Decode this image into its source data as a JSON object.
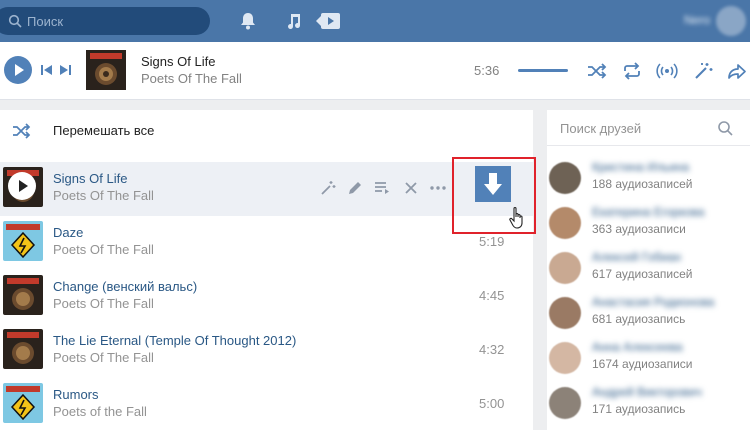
{
  "header": {
    "search_placeholder": "Поиск",
    "user_name": "Nero"
  },
  "player": {
    "title": "Signs Of Life",
    "artist": "Poets Of The Fall",
    "time": "5:36",
    "progress": 0.0
  },
  "list": {
    "shuffle_label": "Перемешать все",
    "tracks": [
      {
        "title": "Signs Of Life",
        "artist": "Poets Of The Fall",
        "time": ""
      },
      {
        "title": "Daze",
        "artist": "Poets Of The Fall",
        "time": "5:19"
      },
      {
        "title": "Change (венский вальс)",
        "artist": "Poets Of The Fall",
        "time": "4:45"
      },
      {
        "title": "The Lie Eternal (Temple Of Thought 2012)",
        "artist": "Poets Of The Fall",
        "time": "4:32"
      },
      {
        "title": "Rumors",
        "artist": "Poets of the Fall",
        "time": "5:00"
      }
    ]
  },
  "friends": {
    "search_placeholder": "Поиск друзей",
    "items": [
      {
        "name": "Кристина Ильина",
        "count": "188 аудиозаписей"
      },
      {
        "name": "Екатерина Егоркова",
        "count": "363 аудиозаписи"
      },
      {
        "name": "Алексей Гобиан",
        "count": "617 аудиозаписей"
      },
      {
        "name": "Анастасия Родионова",
        "count": "681 аудиозапись"
      },
      {
        "name": "Анна Алексеева",
        "count": "1674 аудиозаписи"
      },
      {
        "name": "Андрей Викторович",
        "count": "171 аудиозапись"
      }
    ]
  },
  "colors": {
    "header": "#4a76a8",
    "accent": "#5181b8",
    "highlight": "#e0222b",
    "link": "#2a5885"
  }
}
